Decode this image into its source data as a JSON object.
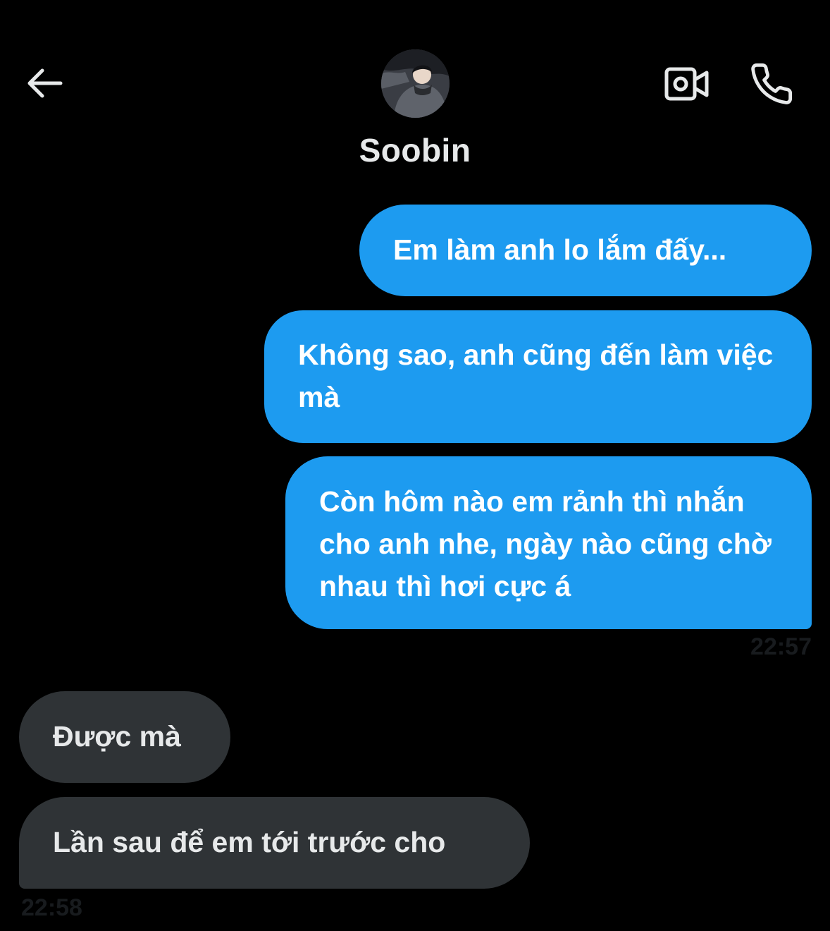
{
  "header": {
    "contact_name": "Soobin",
    "icons": {
      "back": "arrow-left-icon",
      "video": "video-camera-icon",
      "call": "phone-icon"
    }
  },
  "messages": [
    {
      "direction": "outgoing",
      "text": "Em làm anh lo lắm đấy..."
    },
    {
      "direction": "outgoing",
      "text": "Không sao, anh cũng đến làm việc mà"
    },
    {
      "direction": "outgoing",
      "text": "Còn hôm nào em rảnh thì nhắn cho anh nhe, ngày nào cũng chờ nhau thì hơi cực á"
    },
    {
      "direction": "incoming",
      "text": "Được mà"
    },
    {
      "direction": "incoming",
      "text": "Lần sau để em tới trước cho"
    }
  ],
  "timestamps": {
    "outgoing_group": "22:57",
    "incoming_group": "22:58"
  },
  "colors": {
    "background": "#000000",
    "outgoing_bubble": "#1d9bf0",
    "incoming_bubble": "#2f3336",
    "text": "#ffffff"
  }
}
